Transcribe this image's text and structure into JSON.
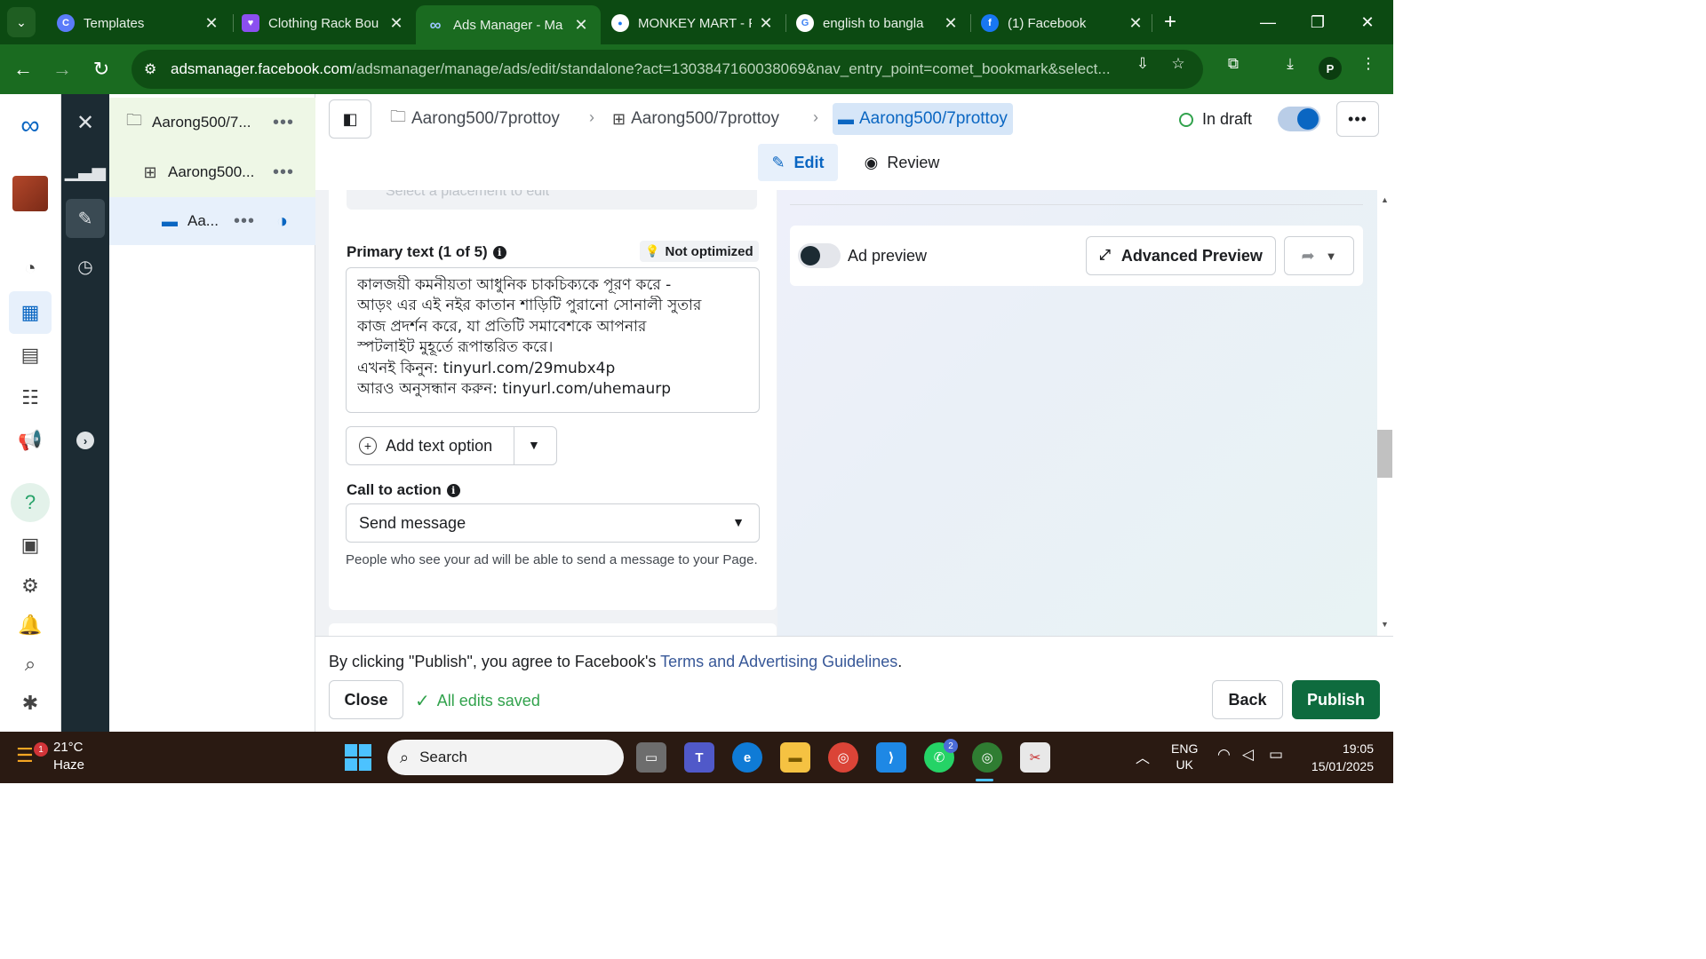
{
  "browser": {
    "tabs": [
      {
        "title": "Templates",
        "favicon": "C",
        "color": "#5b7cfa"
      },
      {
        "title": "Clothing Rack Bou",
        "favicon": "♥",
        "color": "#8b4ff0"
      },
      {
        "title": "Ads Manager - Ma",
        "favicon": "∞",
        "color": "#2d88ff"
      },
      {
        "title": "MONKEY MART - F",
        "favicon": "●",
        "color": "#1877f2"
      },
      {
        "title": "english to bangla",
        "favicon": "G",
        "color": "#4285f4"
      },
      {
        "title": "(1) Facebook",
        "favicon": "f",
        "color": "#1877f2"
      }
    ],
    "url_host": "adsmanager.facebook.com",
    "url_path": "/adsmanager/manage/ads/edit/standalone?act=1303847160038069&nav_entry_point=comet_bookmark&select...",
    "profile_initial": "P"
  },
  "tree": {
    "campaign": "Aarong500/7...",
    "adset": "Aarong500...",
    "ad": "Aa..."
  },
  "header": {
    "breadcrumbs": [
      "Aarong500/7prottoy",
      "Aarong500/7prottoy",
      "Aarong500/7prottoy"
    ],
    "status": "In draft",
    "mode_edit": "Edit",
    "mode_review": "Review"
  },
  "editor": {
    "placement_placeholder": "Select a placement to edit",
    "primary_text_label": "Primary text (1 of 5)",
    "not_optimized": "Not optimized",
    "primary_text_lines": [
      "কালজয়ী কমনীয়তা আধুনিক চাকচিক্যকে পূরণ করে -",
      "আড়ং এর এই নইর কাতান শাড়িটি পুরানো সোনালী সুতার",
      "কাজ প্রদর্শন করে, যা প্রতিটি সমাবেশকে আপনার",
      "স্পটলাইট মুহূর্তে রূপান্তরিত করে।",
      "এখনই কিনুন: tinyurl.com/29mubx4p",
      "আরও অনুসন্ধান করুন: tinyurl.com/uhemaurp"
    ],
    "add_text_option": "Add text option",
    "cta_label": "Call to action",
    "cta_value": "Send message",
    "cta_help": "People who see your ad will be able to send a message to your Page."
  },
  "preview": {
    "ad_preview": "Ad preview",
    "advanced_preview": "Advanced Preview"
  },
  "footer": {
    "terms_prefix": "By clicking \"Publish\", you agree to Facebook's ",
    "terms_link": "Terms and Advertising Guidelines",
    "terms_suffix": ".",
    "close": "Close",
    "saved": "All edits saved",
    "back": "Back",
    "publish": "Publish"
  },
  "taskbar": {
    "weather_temp": "21°C",
    "weather_desc": "Haze",
    "weather_badge": "1",
    "search": "Search",
    "whatsapp_badge": "2",
    "lang_1": "ENG",
    "lang_2": "UK",
    "time": "19:05",
    "date": "15/01/2025"
  }
}
